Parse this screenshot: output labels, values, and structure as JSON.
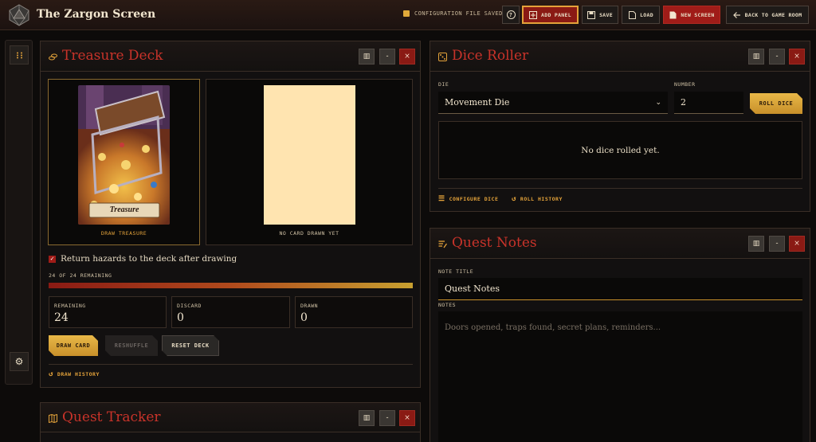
{
  "app": {
    "title": "The Zargon Screen",
    "status_text": "CONFIGURATION FILE SAVED",
    "accent": "#e3a23a",
    "danger": "#8a1a14"
  },
  "toolbar": {
    "help_label": "?",
    "add_panel_label": "ADD PANEL",
    "save_label": "SAVE",
    "load_label": "LOAD",
    "new_screen_label": "NEW SCREEN",
    "back_label": "BACK TO GAME ROOM"
  },
  "treasure": {
    "title": "Treasure Deck",
    "card_caption": "Treasure",
    "draw_slot_label": "DRAW TREASURE",
    "empty_slot_label": "NO CARD DRAWN YET",
    "return_hazards_label": "Return hazards to the deck after drawing",
    "return_hazards_checked": true,
    "remaining_text": "24 OF 24 REMAINING",
    "remaining_fraction": 1.0,
    "stats": [
      {
        "label": "REMAINING",
        "value": "24"
      },
      {
        "label": "DISCARD",
        "value": "0"
      },
      {
        "label": "DRAWN",
        "value": "0"
      }
    ],
    "draw_card_label": "DRAW CARD",
    "reshuffle_label": "RESHUFFLE",
    "reset_deck_label": "RESET DECK",
    "history_label": "DRAW HISTORY"
  },
  "dice": {
    "title": "Dice Roller",
    "die_label": "DIE",
    "die_value": "Movement Die",
    "number_label": "NUMBER",
    "number_value": "2",
    "roll_label": "ROLL DICE",
    "empty_text": "No dice rolled yet.",
    "configure_label": "CONFIGURE DICE",
    "history_label": "ROLL HISTORY"
  },
  "notes": {
    "title": "Quest Notes",
    "note_title_label": "NOTE TITLE",
    "note_title_value": "Quest Notes",
    "notes_label": "NOTES",
    "notes_placeholder": "Doors opened, traps found, secret plans, reminders..."
  },
  "quest": {
    "title": "Quest Tracker"
  }
}
